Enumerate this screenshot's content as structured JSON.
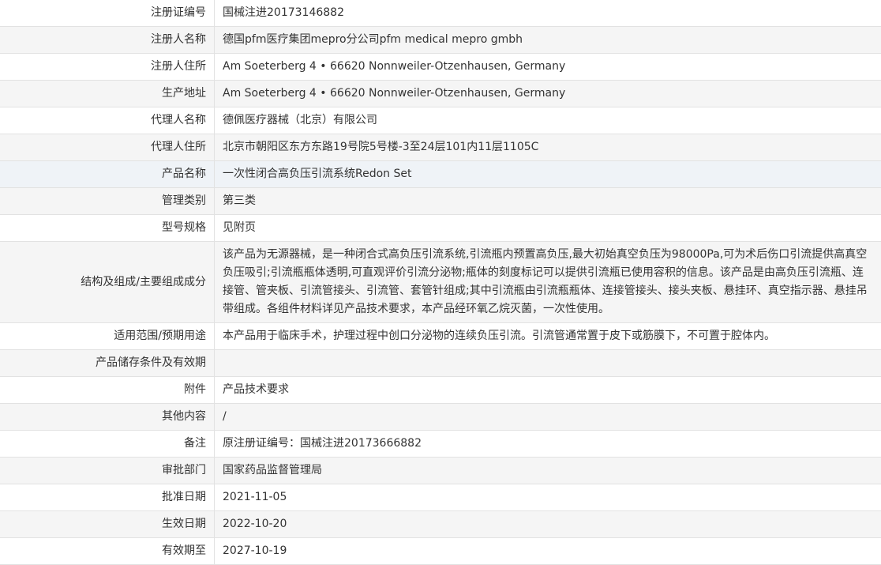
{
  "rows": [
    {
      "label": "注册证编号",
      "value": "国械注进20173146882"
    },
    {
      "label": "注册人名称",
      "value": "德国pfm医疗集团mepro分公司pfm medical mepro gmbh"
    },
    {
      "label": "注册人住所",
      "value": "Am Soeterberg 4 • 66620 Nonnweiler-Otzenhausen, Germany"
    },
    {
      "label": "生产地址",
      "value": "Am Soeterberg 4 • 66620 Nonnweiler-Otzenhausen, Germany"
    },
    {
      "label": "代理人名称",
      "value": "德佩医疗器械（北京）有限公司"
    },
    {
      "label": "代理人住所",
      "value": "北京市朝阳区东方东路19号院5号楼-3至24层101内11层1105C"
    },
    {
      "label": "产品名称",
      "value": "一次性闭合高负压引流系统Redon Set"
    },
    {
      "label": "管理类别",
      "value": "第三类"
    },
    {
      "label": "型号规格",
      "value": "见附页"
    },
    {
      "label": "结构及组成/主要组成成分",
      "value": "该产品为无源器械，是一种闭合式高负压引流系统,引流瓶内预置高负压,最大初始真空负压为98000Pa,可为术后伤口引流提供高真空负压吸引;引流瓶瓶体透明,可直观评价引流分泌物;瓶体的刻度标记可以提供引流瓶已使用容积的信息。该产品是由高负压引流瓶、连接管、管夹板、引流管接头、引流管、套管针组成;其中引流瓶由引流瓶瓶体、连接管接头、接头夹板、悬挂环、真空指示器、悬挂吊带组成。各组件材料详见产品技术要求，本产品经环氧乙烷灭菌，一次性使用。"
    },
    {
      "label": "适用范围/预期用途",
      "value": "本产品用于临床手术，护理过程中创口分泌物的连续负压引流。引流管通常置于皮下或筋膜下，不可置于腔体内。"
    },
    {
      "label": "产品储存条件及有效期",
      "value": ""
    },
    {
      "label": "附件",
      "value": "产品技术要求"
    },
    {
      "label": "其他内容",
      "value": "/"
    },
    {
      "label": "备注",
      "value": "原注册证编号：国械注进20173666882"
    },
    {
      "label": "审批部门",
      "value": "国家药品监督管理局"
    },
    {
      "label": "批准日期",
      "value": "2021-11-05"
    },
    {
      "label": "生效日期",
      "value": "2022-10-20"
    },
    {
      "label": "有效期至",
      "value": "2027-10-19"
    }
  ]
}
